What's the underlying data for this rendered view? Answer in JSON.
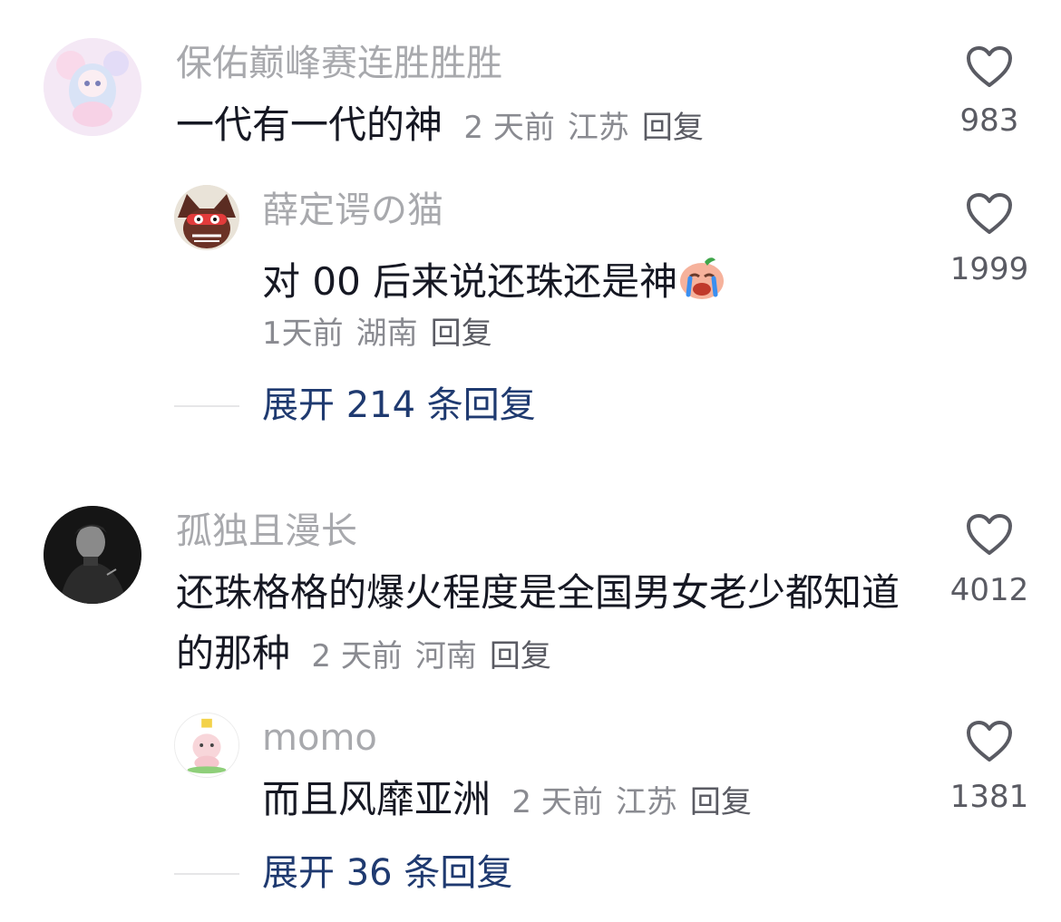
{
  "comments": [
    {
      "username": "保佑巅峰赛连胜胜胜",
      "text": "一代有一代的神",
      "time": "2 天前",
      "location": "江苏",
      "reply_label": "回复",
      "likes": "983",
      "replies": [
        {
          "username": "薛定谔の猫",
          "text": "对 00 后来说还珠还是神",
          "emoji": "crying-face-emoji",
          "time": "1天前",
          "location": "湖南",
          "reply_label": "回复",
          "likes": "1999"
        }
      ],
      "expand_label": "展开 214 条回复"
    },
    {
      "username": "孤独且漫长",
      "text_line1": "还珠格格的爆火程度是全国男女老少都知道",
      "text_line2": "的那种",
      "time": "2 天前",
      "location": "河南",
      "reply_label": "回复",
      "likes": "4012",
      "replies": [
        {
          "username": "momo",
          "text": "而且风靡亚洲",
          "time": "2 天前",
          "location": "江苏",
          "reply_label": "回复",
          "likes": "1381"
        }
      ],
      "expand_label": "展开 36 条回复"
    }
  ]
}
